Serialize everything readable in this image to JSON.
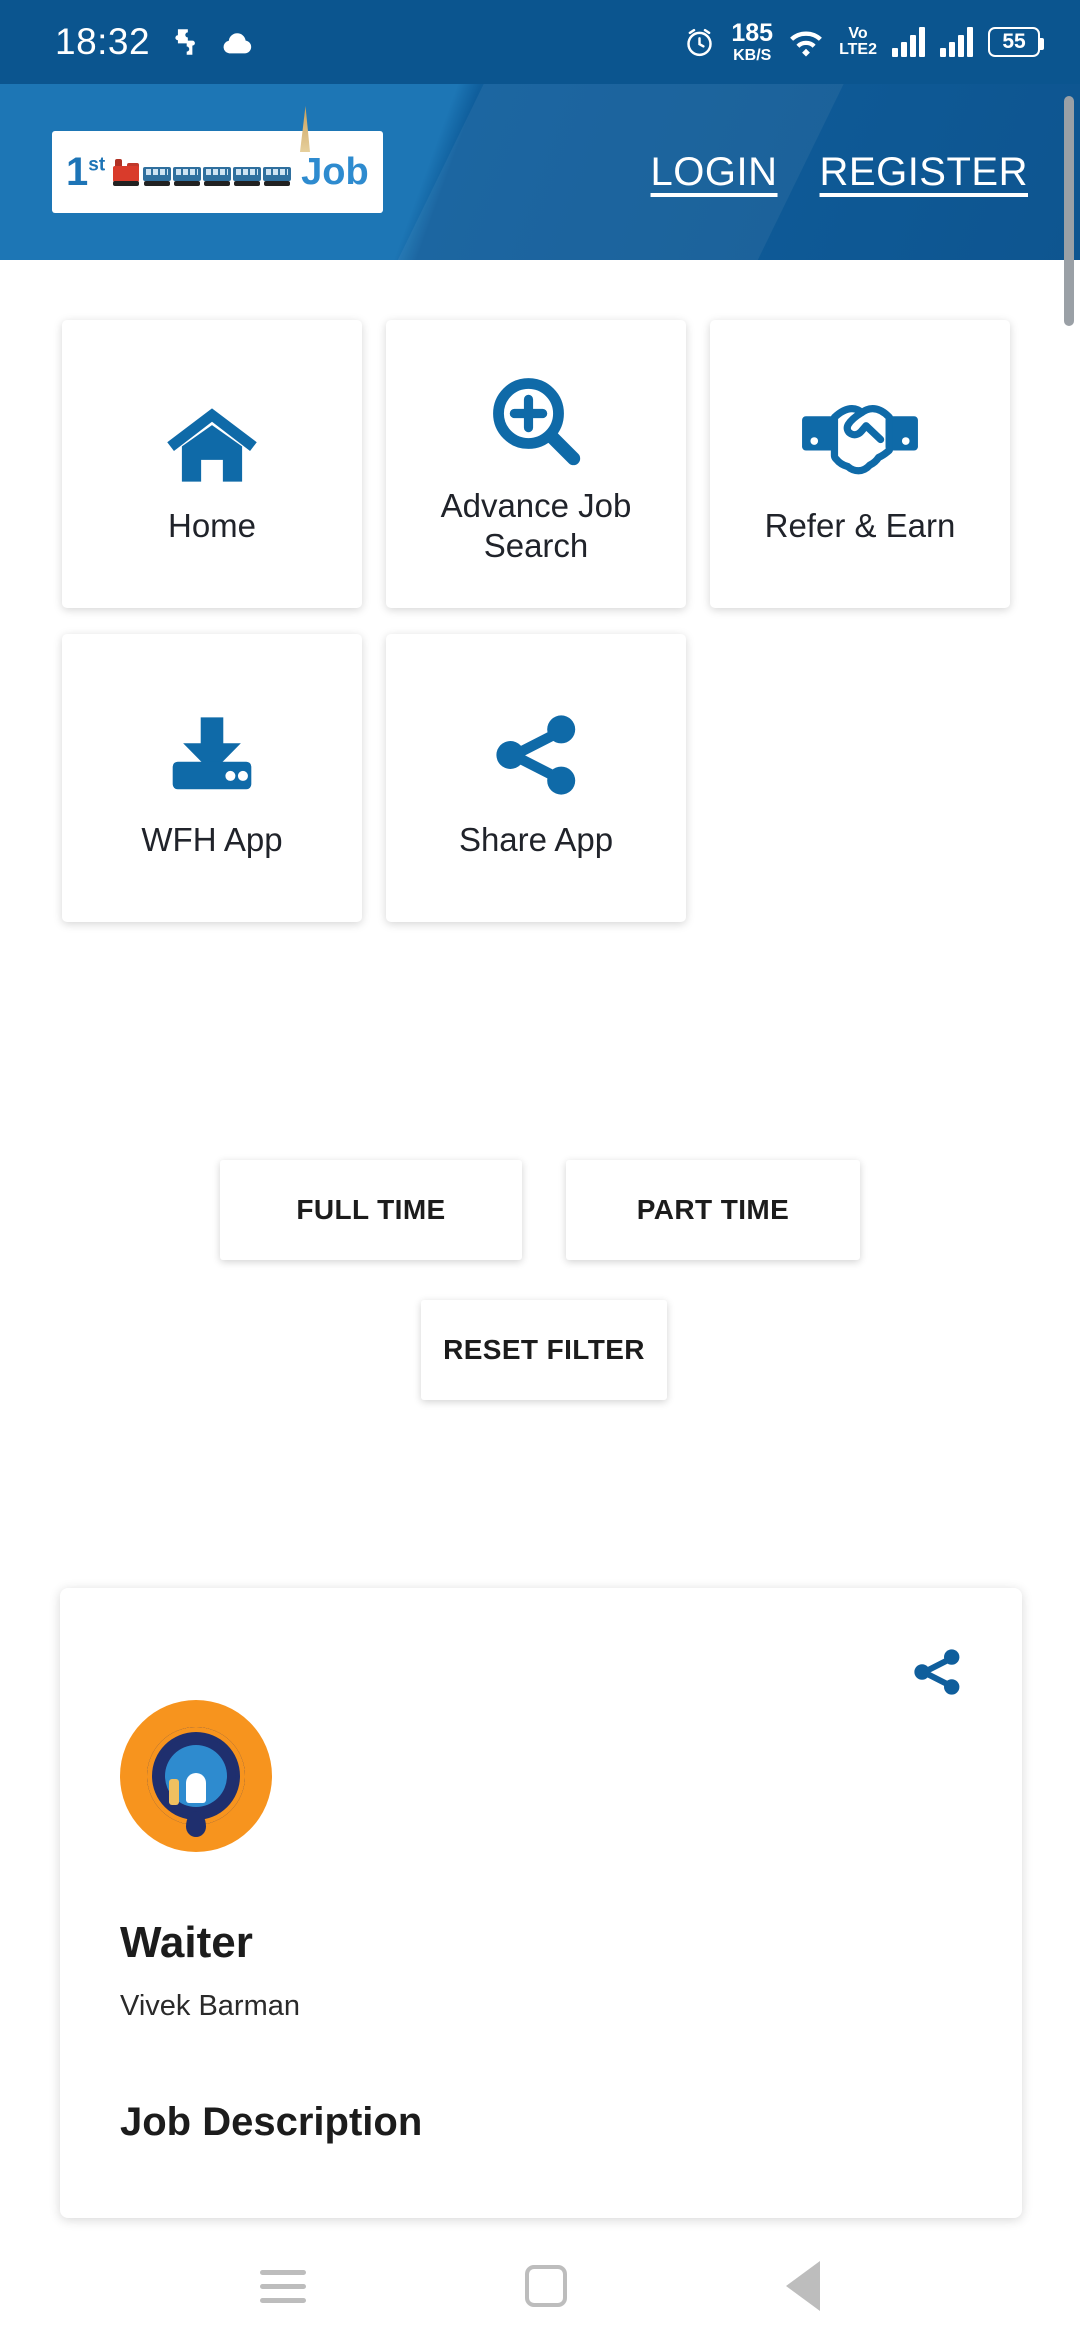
{
  "status_bar": {
    "time": "18:32",
    "icons_left": [
      "puzzle-icon",
      "cloud-icon"
    ],
    "alarm_icon": "alarm-icon",
    "network_speed_value": "185",
    "network_speed_unit": "KB/S",
    "wifi_icon": "wifi-icon",
    "volte_line1": "Vo",
    "volte_line2": "LTE2",
    "battery_level": "55"
  },
  "header": {
    "logo": {
      "prefix": "1",
      "prefix_sup": "st",
      "suffix": "Job",
      "train_icon": "train-icon"
    },
    "login_label": "LOGIN",
    "register_label": "REGISTER",
    "accent_color": "#1d76b5"
  },
  "menu": {
    "tiles": [
      {
        "label": "Home",
        "icon": "home-icon"
      },
      {
        "label": "Advance Job Search",
        "icon": "search-plus-icon"
      },
      {
        "label": "Refer & Earn",
        "icon": "handshake-icon"
      },
      {
        "label": "WFH App",
        "icon": "download-icon"
      },
      {
        "label": "Share App",
        "icon": "share-icon"
      }
    ],
    "icon_color": "#0f6aa8"
  },
  "filters": {
    "full_time_label": "FULL TIME",
    "part_time_label": "PART TIME",
    "reset_label": "RESET FILTER"
  },
  "job_card": {
    "title": "Waiter",
    "posted_by": "Vivek Barman",
    "description_heading": "Job Description",
    "share_icon": "share-icon",
    "company_logo_icon": "company-emblem-icon",
    "logo_bg_color": "#f7941e"
  },
  "nav_bar": {
    "recents_icon": "recents-icon",
    "home_icon": "home-square-icon",
    "back_icon": "back-triangle-icon"
  }
}
